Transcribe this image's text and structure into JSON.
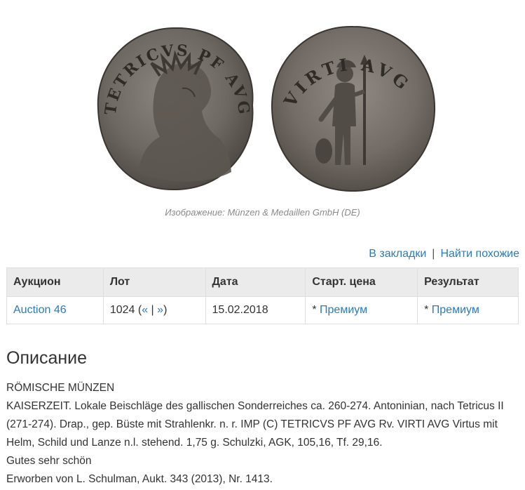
{
  "image": {
    "caption": "Изображение: Münzen & Medaillen GmbH (DE)",
    "obverse_legend": "TETRICVS PF AVG",
    "reverse_legend": "VIRTI AVG"
  },
  "actions": {
    "bookmark": "В закладки",
    "separator": "|",
    "similar": "Найти похожие"
  },
  "table": {
    "headers": [
      "Аукцион",
      "Лот",
      "Дата",
      "Старт. цена",
      "Результат"
    ],
    "row": {
      "auction": "Auction 46",
      "lot_number": "1024",
      "lot_open": " (",
      "lot_prev": "«",
      "lot_sep": " | ",
      "lot_next": "»",
      "lot_close": ")",
      "date": "15.02.2018",
      "start_star": "* ",
      "start_price": "Премиум",
      "result_star": "* ",
      "result": "Премиум"
    }
  },
  "description": {
    "title": "Описание",
    "lines": [
      "RÖMISCHE MÜNZEN",
      "KAISERZEIT. Lokale Beischläge des gallischen Sonderreiches ca. 260-274. Antoninian, nach Tetricus II (271-274). Drap., gep. Büste mit Strahlenkr. n. r. IMP (C) TETRICVS PF AVG Rv. VIRTI AVG Virtus mit Helm, Schild und Lanze n.l. stehend. 1,75 g. Schulzki, AGK, 105,16, Tf. 29,16.",
      "Gutes sehr schön",
      "Erworben von L. Schulman, Aukt. 343 (2013), Nr. 1413."
    ]
  }
}
